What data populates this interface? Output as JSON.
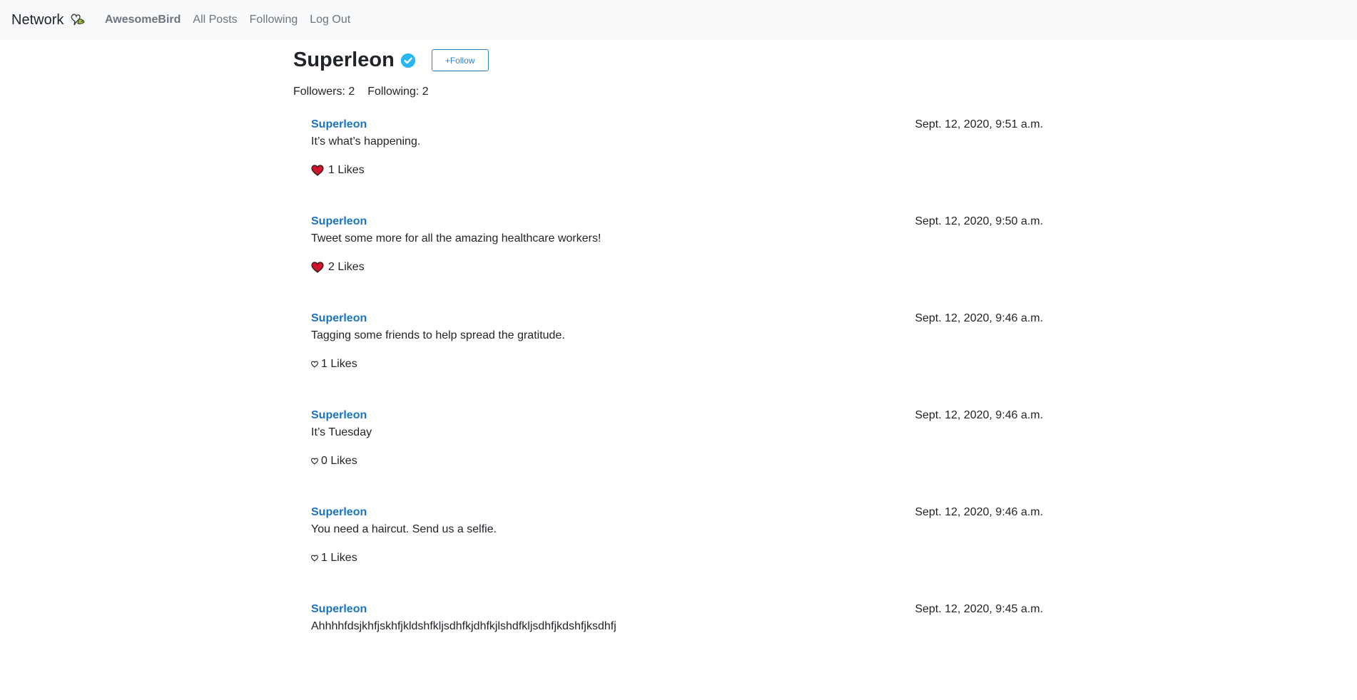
{
  "navbar": {
    "brand": "Network",
    "user": "AwesomeBird",
    "links": [
      "All Posts",
      "Following",
      "Log Out"
    ]
  },
  "profile": {
    "name": "Superleon",
    "follow_label": "+Follow",
    "followers_label": "Followers: 2",
    "following_label": "Following: 2"
  },
  "posts": [
    {
      "author": "Superleon",
      "time": "Sept. 12, 2020, 9:51 a.m.",
      "body": "It’s what’s happening.",
      "liked": true,
      "likes": "1 Likes"
    },
    {
      "author": "Superleon",
      "time": "Sept. 12, 2020, 9:50 a.m.",
      "body": "Tweet some more for all the amazing healthcare workers!",
      "liked": true,
      "likes": "2 Likes"
    },
    {
      "author": "Superleon",
      "time": "Sept. 12, 2020, 9:46 a.m.",
      "body": "Tagging some friends to help spread the gratitude.",
      "liked": false,
      "likes": "1 Likes"
    },
    {
      "author": "Superleon",
      "time": "Sept. 12, 2020, 9:46 a.m.",
      "body": "It’s Tuesday",
      "liked": false,
      "likes": "0 Likes"
    },
    {
      "author": "Superleon",
      "time": "Sept. 12, 2020, 9:46 a.m.",
      "body": "You need a haircut. Send us a selfie.",
      "liked": false,
      "likes": "1 Likes"
    },
    {
      "author": "Superleon",
      "time": "Sept. 12, 2020, 9:45 a.m.",
      "body": "Ahhhhfdsjkhfjskhfjkldshfkljsdhfkjdhfkjlshdfkljsdhfjkdshfjksdhfj",
      "liked": false,
      "likes": ""
    }
  ],
  "colors": {
    "navbar_bg": "#f8f9fa",
    "link_blue": "#1a73c8",
    "verified": "#1da1f2",
    "heart_filled": "#d0142c"
  },
  "icons": {
    "brand": "bird-heart-icon",
    "verified": "verified-badge-icon",
    "like_filled": "heart-filled-icon",
    "like_outline": "heart-outline-icon"
  }
}
